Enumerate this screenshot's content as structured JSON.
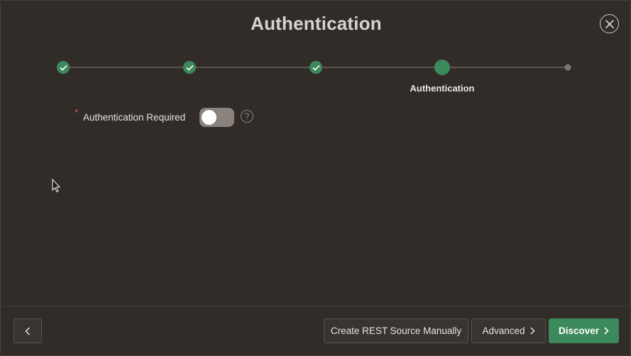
{
  "dialog": {
    "title": "Authentication"
  },
  "wizard": {
    "steps": [
      {
        "status": "complete"
      },
      {
        "status": "complete"
      },
      {
        "status": "complete"
      },
      {
        "status": "current",
        "label": "Authentication"
      },
      {
        "status": "upcoming"
      }
    ],
    "current_label": "Authentication"
  },
  "form": {
    "required_marker": "*",
    "auth_required_label": "Authentication Required",
    "auth_required_value": false,
    "help_glyph": "?"
  },
  "footer": {
    "back_icon": "chevron-left-icon",
    "create_manual_label": "Create REST Source Manually",
    "advanced_label": "Advanced",
    "discover_label": "Discover"
  },
  "colors": {
    "accent": "#3c8a5b",
    "background": "#322c29",
    "required": "#e05d52"
  }
}
